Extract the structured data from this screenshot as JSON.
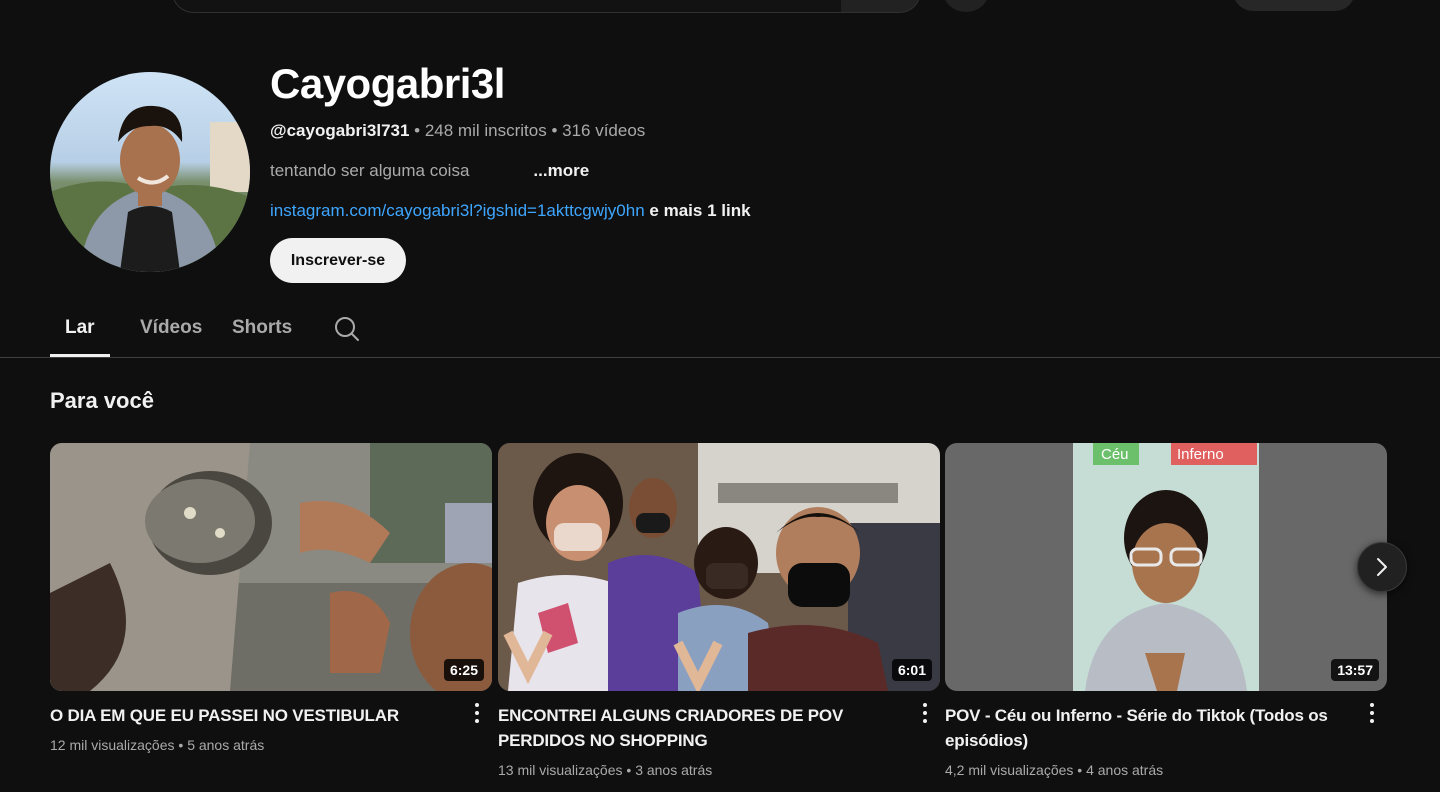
{
  "channel": {
    "name": "Cayogabri3l",
    "handle": "@cayogabri3l731",
    "separator": " • ",
    "subscribers": "248 mil inscritos",
    "video_count": "316 vídeos",
    "description": "tentando ser alguma coisa",
    "more_label": "...more",
    "link_text": "instagram.com/cayogabri3l?igshid=1akttcgwjy0hn",
    "extra_links": "e mais 1 link",
    "subscribe_label": "Inscrever-se"
  },
  "tabs": [
    {
      "label": "Lar",
      "active": true
    },
    {
      "label": "Vídeos",
      "active": false
    },
    {
      "label": "Shorts",
      "active": false
    }
  ],
  "section": {
    "title": "Para você"
  },
  "videos": [
    {
      "title": "O DIA EM QUE EU PASSEI NO VESTIBULAR",
      "duration": "6:25",
      "views": "12 mil visualizações",
      "age": "5 anos atrás"
    },
    {
      "title": "ENCONTREI ALGUNS CRIADORES DE POV PERDIDOS NO SHOPPING",
      "duration": "6:01",
      "views": "13 mil visualizações",
      "age": "3 anos atrás"
    },
    {
      "title": "POV - Céu ou Inferno - Série do Tiktok (Todos os episódios)",
      "duration": "13:57",
      "views": "4,2 mil visualizações",
      "age": "4 anos atrás",
      "labels": {
        "left": "Céu",
        "right": "Inferno"
      }
    }
  ],
  "icons": {
    "tab_search": "search-icon",
    "kebab": "more-vert-icon",
    "next": "chevron-right-icon"
  },
  "colors": {
    "background": "#0f0f0f",
    "link": "#3ea6ff",
    "text_secondary": "#aaaaaa"
  }
}
